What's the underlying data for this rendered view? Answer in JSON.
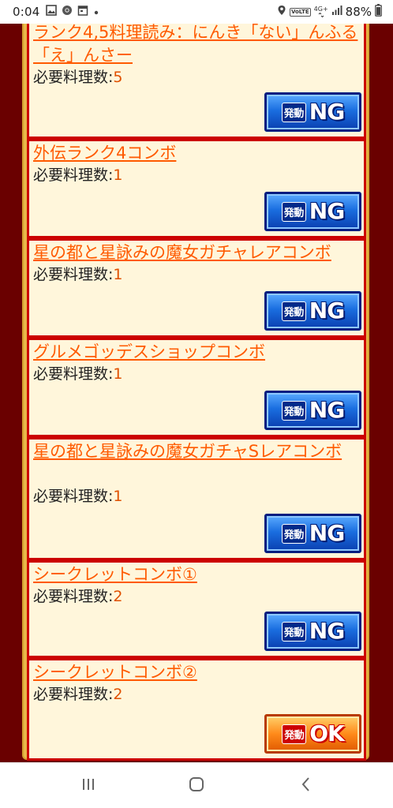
{
  "status_bar": {
    "time": "0:04",
    "volte": "VoLTE",
    "network": "4G+",
    "battery": "88%"
  },
  "count_label": "必要料理数:",
  "button_prefix": "発動",
  "combos": [
    {
      "title": "ランク4,5料理読み：にんき「ない」んふる「え」んさー",
      "count": "5",
      "status": "NG"
    },
    {
      "title": "外伝ランク4コンボ",
      "count": "1",
      "status": "NG"
    },
    {
      "title": "星の都と星詠みの魔女ガチャレアコンボ",
      "count": "1",
      "status": "NG"
    },
    {
      "title": "グルメゴッデスショップコンボ",
      "count": "1",
      "status": "NG"
    },
    {
      "title": "星の都と星詠みの魔女ガチャSレアコンボ",
      "count": "1",
      "status": "NG"
    },
    {
      "title": "シークレットコンボ①",
      "count": "2",
      "status": "NG"
    },
    {
      "title": "シークレットコンボ②",
      "count": "2",
      "status": "OK"
    }
  ],
  "colors": {
    "page_bg": "#6a0000",
    "card_bg": "#fff6db",
    "card_border": "#cc0000",
    "title_orange": "#ff5a00",
    "ng_blue": "#1a6ee0",
    "ok_orange": "#ff8a1a"
  }
}
